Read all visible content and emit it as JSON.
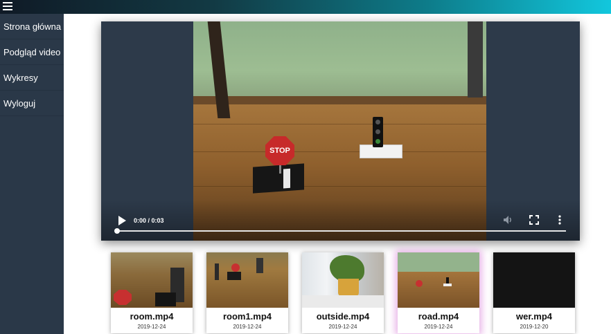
{
  "header": {
    "menu_icon": "hamburger-icon"
  },
  "sidebar": {
    "items": [
      {
        "label": "Strona główna"
      },
      {
        "label": "Podgląd video"
      },
      {
        "label": "Wykresy"
      },
      {
        "label": "Wyloguj"
      }
    ]
  },
  "player": {
    "time": "0:00 / 0:03",
    "progress": 0,
    "frame": {
      "stop_text": "STOP"
    },
    "icons": {
      "play": "play-icon",
      "volume": "volume-icon",
      "fullscreen": "fullscreen-icon",
      "more": "more-vert-icon"
    }
  },
  "videos": [
    {
      "name": "room.mp4",
      "date": "2019-12-24",
      "selected": false
    },
    {
      "name": "room1.mp4",
      "date": "2019-12-24",
      "selected": false
    },
    {
      "name": "outside.mp4",
      "date": "2019-12-24",
      "selected": false
    },
    {
      "name": "road.mp4",
      "date": "2019-12-24",
      "selected": true
    },
    {
      "name": "wer.mp4",
      "date": "2019-12-20",
      "selected": false
    }
  ],
  "colors": {
    "sidebar": "#2a3848",
    "selected_glow": "#dc8cdc",
    "accent": "#12c7dd"
  }
}
